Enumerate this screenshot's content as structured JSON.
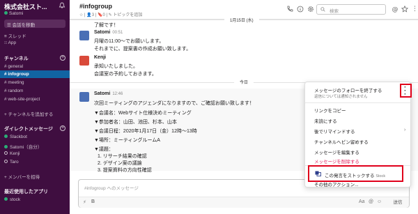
{
  "sidebar": {
    "workspace": "株式会社スト...",
    "user": "Satomi",
    "jump_label": "会話を移動",
    "threads": "スレッド",
    "apps": "App",
    "channels_header": "チャンネル",
    "channels": [
      "# general",
      "# infogroup",
      "# meeting",
      "# random",
      "# web-site-project"
    ],
    "add_channel": "+ チャンネルを追加する",
    "dm_header": "ダイレクトメッセージ",
    "dms": [
      "Slackbot",
      "Satomi（自分）",
      "Kenji",
      "Taro"
    ],
    "invite": "+ メンバーを招待",
    "recent_apps_header": "最近使用したアプリ",
    "recent_apps": [
      "stock"
    ]
  },
  "header": {
    "channel": "#infogroup",
    "meta": "☆ | 👤3 | 🔖0 | ✎ トピックを追加",
    "search_placeholder": "検索"
  },
  "messages": {
    "date1": "1月15日 (水)",
    "m0_text": "了解です！",
    "m1_author": "Satomi",
    "m1_time": "00:51",
    "m1_lines": [
      "月曜の11:00〜でお願いします。",
      "それまでに、提案書の作成お願い致します。"
    ],
    "m2_author": "Kenji",
    "m2_lines": [
      "承知いたしました。",
      "会議室の予約しておきます。"
    ],
    "date2": "今日",
    "m3_author": "Satomi",
    "m3_time": "12:46",
    "m3_lines": [
      "次回ミーティングのアジェンダになりますので、ご確認お願い致します！",
      "▼会議名：Webサイト仕様決めミーティング",
      "▼参加者名：山田、池田、杉本、山本",
      "▼会議日程：2020年1月17日（金）12時〜13時",
      "▼場所：ミーティングルームA",
      "▼議題：",
      "1. リサーチ結果の確認",
      "2. デザイン案の議論",
      "3. 提案資料の方向性確認"
    ]
  },
  "composer": {
    "placeholder": "#infogroup へのメッセージ",
    "send": "送信"
  },
  "menu": {
    "follow": "メッセージのフォローを終了する",
    "follow_sub": "返信については通知されません",
    "copy_link": "リンクをコピー",
    "mark_unread": "未読にする",
    "remind": "後でリマインドする",
    "pin": "チャンネルへピン留めする",
    "edit": "メッセージを編集する",
    "delete": "メッセージを削除する",
    "stock": "この発言をストックする",
    "stock_app": "Stock",
    "more": "その他のアクション..."
  },
  "colors": {
    "sidebar": "#3f0e40",
    "active_channel": "#1164a3",
    "highlight": "#e0001b",
    "danger": "#e01e5a"
  }
}
